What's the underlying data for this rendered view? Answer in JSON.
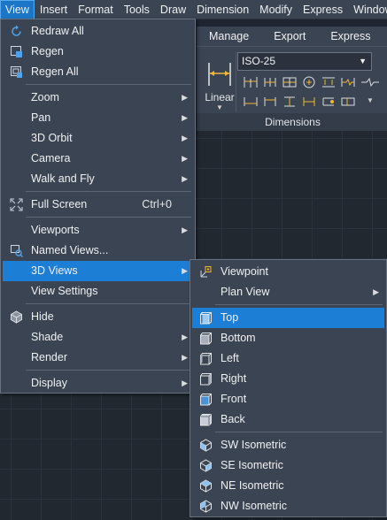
{
  "menubar": {
    "items": [
      "View",
      "Insert",
      "Format",
      "Tools",
      "Draw",
      "Dimension",
      "Modify",
      "Express",
      "Window"
    ]
  },
  "ribbon": {
    "tabs": [
      "Manage",
      "Export",
      "Express"
    ],
    "linear_label": "Linear",
    "dim_style_value": "ISO-25",
    "panel_title": "Dimensions"
  },
  "view_menu": {
    "items": [
      {
        "label": "Redraw All",
        "icon": "redraw-icon"
      },
      {
        "label": "Regen",
        "icon": "regen-icon"
      },
      {
        "label": "Regen All",
        "icon": "regen-all-icon"
      },
      {
        "label": "Zoom",
        "submenu": true
      },
      {
        "label": "Pan",
        "submenu": true
      },
      {
        "label": "3D Orbit",
        "submenu": true
      },
      {
        "label": "Camera",
        "submenu": true
      },
      {
        "label": "Walk and Fly",
        "submenu": true
      },
      {
        "label": "Full Screen",
        "icon": "full-screen-icon",
        "shortcut": "Ctrl+0"
      },
      {
        "label": "Viewports",
        "submenu": true
      },
      {
        "label": "Named Views...",
        "icon": "named-views-icon"
      },
      {
        "label": "3D Views",
        "submenu": true,
        "highlighted": true
      },
      {
        "label": "View Settings"
      },
      {
        "label": "Hide",
        "icon": "hide-icon"
      },
      {
        "label": "Shade",
        "submenu": true
      },
      {
        "label": "Render",
        "submenu": true
      },
      {
        "label": "Display",
        "submenu": true
      }
    ]
  },
  "views_submenu": {
    "items": [
      {
        "label": "Viewpoint",
        "icon": "viewpoint-icon"
      },
      {
        "label": "Plan View",
        "submenu": true
      },
      {
        "label": "Top",
        "icon": "top-view-icon",
        "highlighted": true
      },
      {
        "label": "Bottom",
        "icon": "bottom-view-icon"
      },
      {
        "label": "Left",
        "icon": "left-view-icon"
      },
      {
        "label": "Right",
        "icon": "right-view-icon"
      },
      {
        "label": "Front",
        "icon": "front-view-icon"
      },
      {
        "label": "Back",
        "icon": "back-view-icon"
      },
      {
        "label": "SW Isometric",
        "icon": "sw-isometric-icon"
      },
      {
        "label": "SE Isometric",
        "icon": "se-isometric-icon"
      },
      {
        "label": "NE Isometric",
        "icon": "ne-isometric-icon"
      },
      {
        "label": "NW Isometric",
        "icon": "nw-isometric-icon"
      }
    ]
  },
  "colors": {
    "menu_bg": "#3b4453",
    "highlight": "#1d7ed6",
    "canvas_bg": "#212830"
  }
}
